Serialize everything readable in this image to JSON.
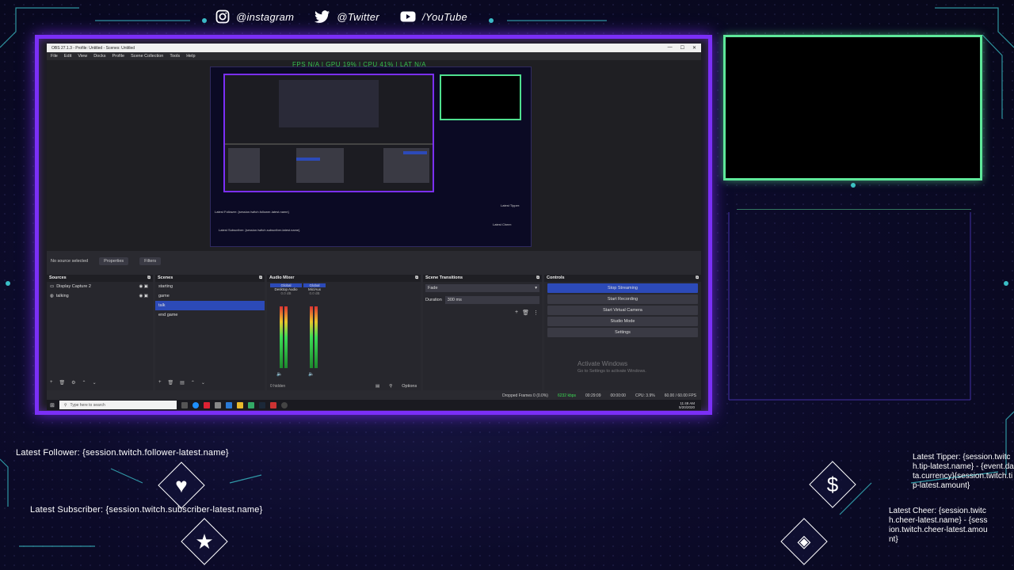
{
  "social": [
    {
      "icon": "instagram-icon",
      "label": "@instagram"
    },
    {
      "icon": "twitter-icon",
      "label": "@Twitter"
    },
    {
      "icon": "youtube-icon",
      "label": "/YouTube"
    }
  ],
  "obs": {
    "window_title": "OBS 27.1.3 - Profile: Untitled - Scenes: Untitled",
    "menu": [
      "File",
      "Edit",
      "View",
      "Docks",
      "Profile",
      "Scene Collection",
      "Tools",
      "Help"
    ],
    "stats_line": "FPS N/A  |  GPU 19%  |  CPU 41%  |  LAT N/A",
    "no_source": "No source selected",
    "properties": "Properties",
    "filters": "Filters",
    "docks": {
      "sources": {
        "title": "Sources",
        "items": [
          "Display Capture 2",
          "talking"
        ]
      },
      "scenes": {
        "title": "Scenes",
        "items": [
          "starting",
          "game",
          "talk",
          "end game"
        ],
        "selected": 2
      },
      "audio": {
        "title": "Audio Mixer",
        "channels": [
          {
            "name": "Desktop Audio",
            "scope": "Global",
            "db": "0.0 dB"
          },
          {
            "name": "Mic/Aux",
            "scope": "Global",
            "db": "0.0 dB"
          }
        ],
        "hidden_label": "0 hidden"
      },
      "transitions": {
        "title": "Scene Transitions",
        "type": "Fade",
        "duration_label": "Duration",
        "duration_value": "300 ms"
      },
      "controls": {
        "title": "Controls",
        "buttons": [
          "Stop Streaming",
          "Start Recording",
          "Start Virtual Camera",
          "Studio Mode",
          "Settings"
        ]
      }
    },
    "options_label": "Options",
    "activate": {
      "title": "Activate Windows",
      "sub": "Go to Settings to activate Windows."
    },
    "status": {
      "dropped": "Dropped Frames 0 (0.0%)",
      "kbps": "6232 kbps",
      "live": "00:29:09",
      "rec": "00:00:00",
      "cpu": "CPU: 3.9%",
      "fps": "60.00 / 60.00 FPS"
    },
    "taskbar": {
      "search_placeholder": "Type here to search",
      "time": "11:48 AM",
      "date": "5/20/2020"
    }
  },
  "alerts": {
    "follower": "Latest Follower: {session.twitch.follower-latest.name}",
    "subscriber": "Latest Subscriber: {session.twitch.subscriber-latest.name}",
    "tipper": "Latest Tipper: {session.twitch.tip-latest.name} - {event.data.currency}{session.twitch.tip-latest.amount}",
    "cheer": "Latest Cheer: {session.twitch.cheer-latest.name} - {session.twitch.cheer-latest.amount}"
  },
  "colors": {
    "frame_purple": "#7b2ff7",
    "webcam_green": "#5ee89a",
    "accent_cyan": "#3fd1d8",
    "obs_blue": "#2c4ab8"
  }
}
